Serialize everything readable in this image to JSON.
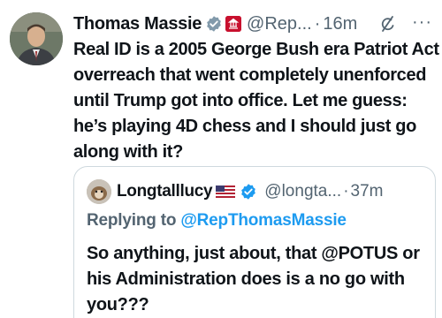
{
  "tweet": {
    "author_name": "Thomas Massie",
    "handle": "@Rep...",
    "separator": "·",
    "time": "16m",
    "more_label": "···",
    "text": "Real ID is a 2005 George Bush era Patriot Act overreach that went completely unenforced until Trump got into office. Let me guess: he’s playing 4D chess and I should just go along with it?",
    "icons": {
      "verified": "verified-badge-icon",
      "affiliation": "government-affiliation-icon",
      "grok": "grok-icon",
      "more": "more-options-icon"
    }
  },
  "quoted_tweet": {
    "author_name": "Longtalllucy",
    "flag": "us-flag",
    "handle": "@longta...",
    "separator": "·",
    "time": "37m",
    "replying_prefix": "Replying to ",
    "replying_to": "@RepThomasMassie",
    "text": "So anything,  just about, that @POTUS or his Administration does is a no go with you???"
  },
  "colors": {
    "accent": "#1d9bf0",
    "secondary_text": "#536471",
    "border": "#cfd9de",
    "gov_badge": "#c8102e"
  }
}
